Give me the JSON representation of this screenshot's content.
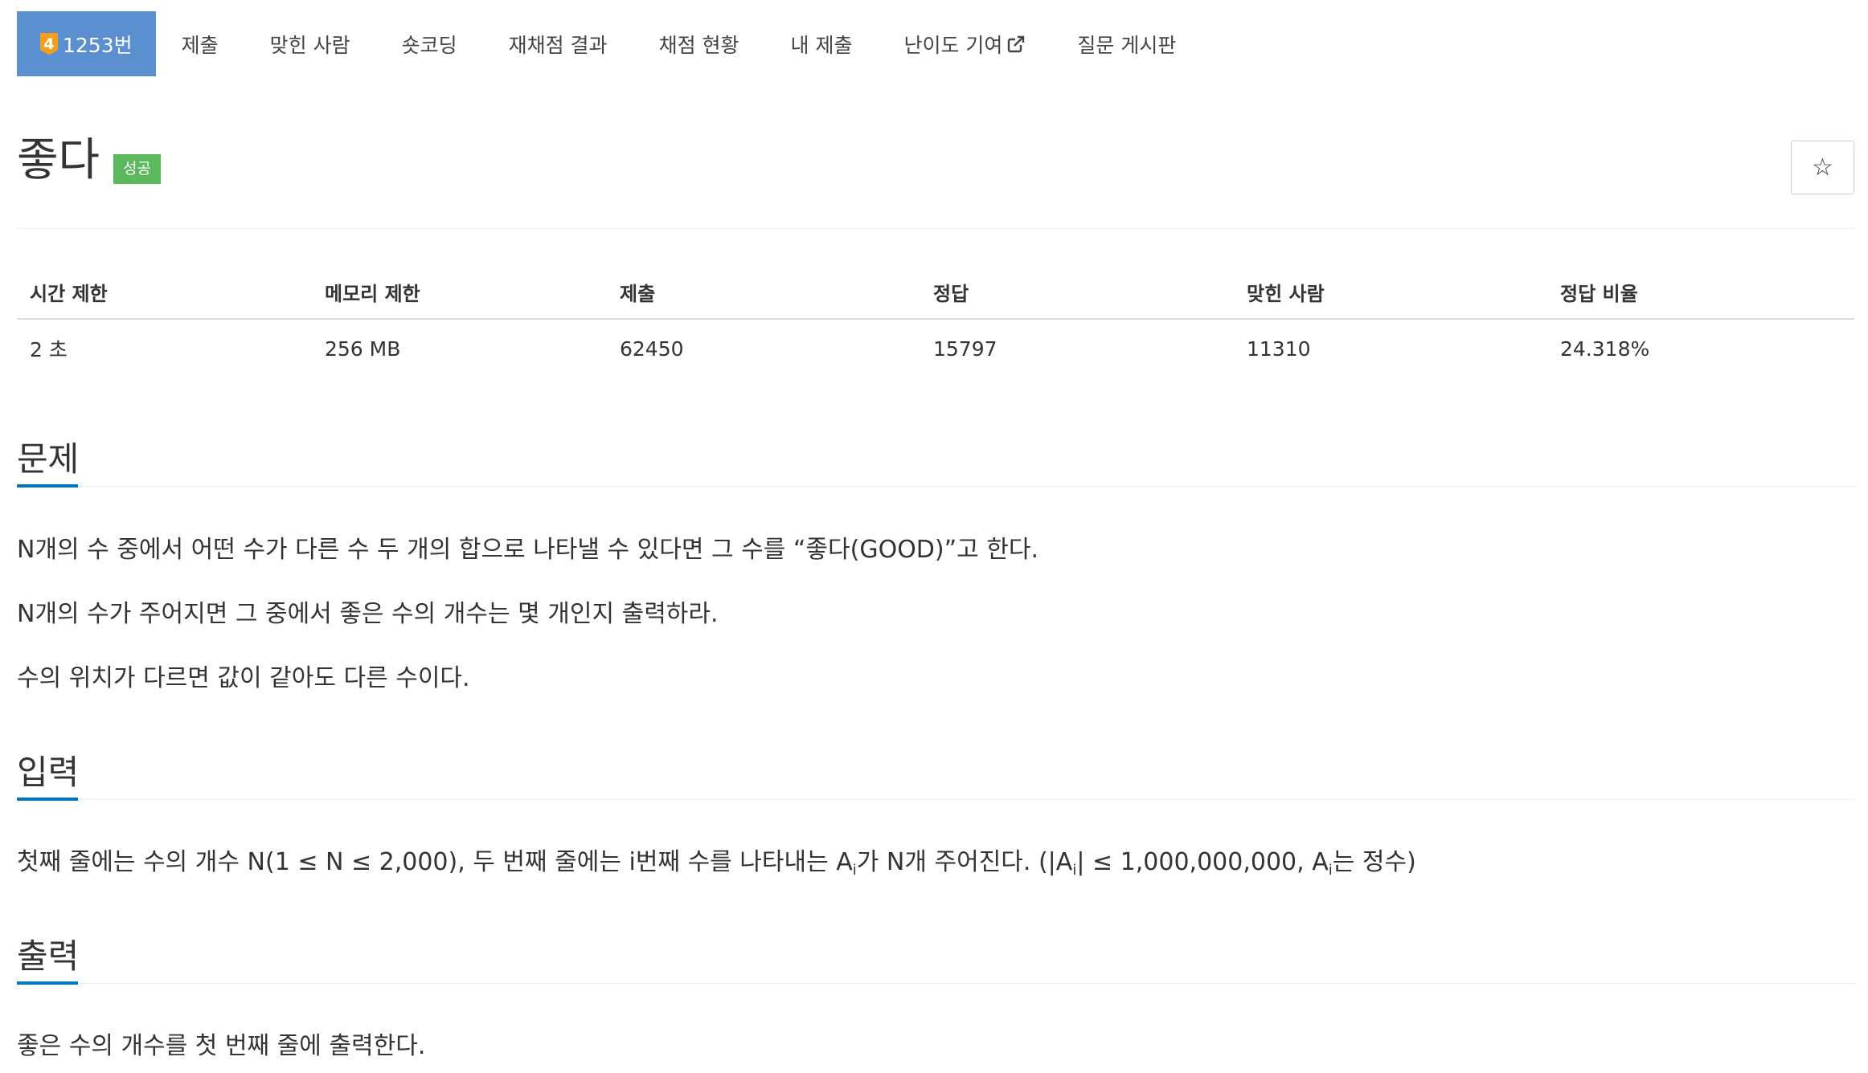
{
  "tabs": {
    "problem_tab": {
      "tier": "4",
      "label": "1253번"
    },
    "items": [
      {
        "label": "제출"
      },
      {
        "label": "맞힌 사람"
      },
      {
        "label": "숏코딩"
      },
      {
        "label": "재채점 결과"
      },
      {
        "label": "채점 현황"
      },
      {
        "label": "내 제출"
      },
      {
        "label": "난이도 기여"
      },
      {
        "label": "질문 게시판"
      }
    ]
  },
  "problem": {
    "title": "좋다",
    "status_badge": "성공",
    "star_icon": "☆"
  },
  "info_table": {
    "headers": [
      "시간 제한",
      "메모리 제한",
      "제출",
      "정답",
      "맞힌 사람",
      "정답 비율"
    ],
    "values": [
      "2 초",
      "256 MB",
      "62450",
      "15797",
      "11310",
      "24.318%"
    ]
  },
  "sections": {
    "description": {
      "heading": "문제",
      "paragraphs": [
        "N개의 수 중에서 어떤 수가 다른 수 두 개의 합으로 나타낼 수 있다면 그 수를 “좋다(GOOD)”고 한다.",
        "N개의 수가 주어지면 그 중에서 좋은 수의 개수는 몇 개인지 출력하라.",
        "수의 위치가 다르면 값이 같아도 다른 수이다."
      ]
    },
    "input": {
      "heading": "입력",
      "text_part1": "첫째 줄에는 수의 개수 N(1 ≤ N ≤ 2,000), 두 번째 줄에는 i번째 수를 나타내는 A",
      "text_part2": "가 N개 주어진다. (|A",
      "text_part3": "| ≤ 1,000,000,000, A",
      "text_part4": "는 정수)",
      "subscript": "i"
    },
    "output": {
      "heading": "출력",
      "paragraph": "좋은 수의 개수를 첫 번째 줄에 출력한다."
    }
  },
  "colors": {
    "active_tab": "#5a8fd0",
    "tier_badge": "#f2a01c",
    "success_badge": "#5cb85c",
    "section_underline": "#0076c0"
  }
}
